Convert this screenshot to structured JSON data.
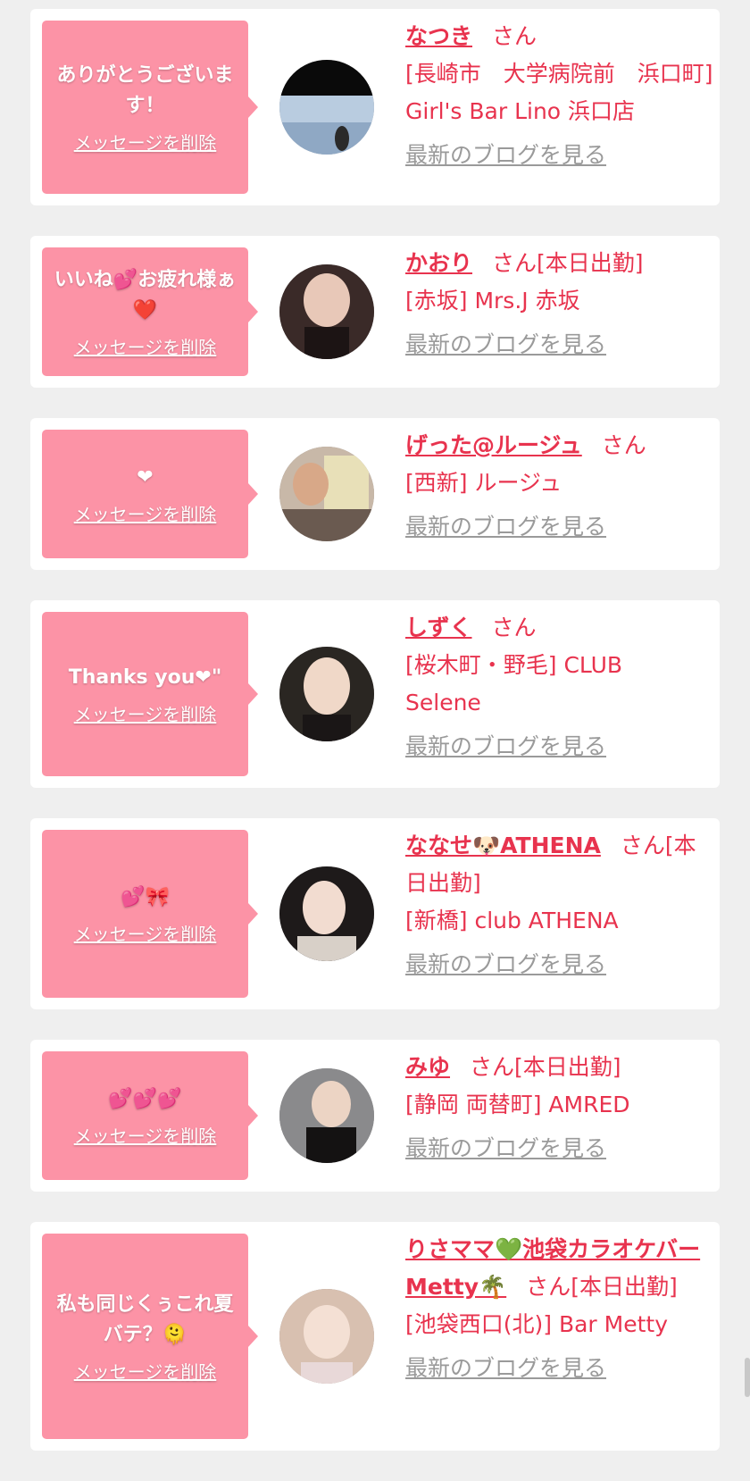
{
  "delete_label": "メッセージを削除",
  "san_label": "さん",
  "blog_label": "最新のブログを見る",
  "colors": {
    "background": "#efefef",
    "bubble": "#fc93a6",
    "accent": "#e8334e",
    "muted": "#9a9a9a"
  },
  "cards": [
    {
      "message": "ありがとうございます！",
      "name": "なつき",
      "status": "",
      "location": "[長崎市　大学病院前　浜口町] Girl's Bar Lino 浜口店"
    },
    {
      "message": "いいね💕お疲れ様ぁ❤️",
      "name": "かおり",
      "status": "[本日出勤]",
      "location": "[赤坂] Mrs.J 赤坂"
    },
    {
      "message": "❤",
      "name": "げった@ルージュ",
      "status": "",
      "location": "[西新] ルージュ"
    },
    {
      "message": "Thanks you❤\"",
      "name": "しずく",
      "status": "",
      "location": "[桜木町・野毛] CLUB Selene"
    },
    {
      "message": "💕🎀",
      "name": "ななせ🐶ATHENA",
      "status": "[本日出勤]",
      "location": "[新橋] club ATHENA"
    },
    {
      "message": "💕💕💕",
      "name": "みゆ",
      "status": "[本日出勤]",
      "location": "[静岡 両替町] AMRED"
    },
    {
      "message": "私も同じくぅこれ夏バテ？🫠",
      "name": "りさママ💚池袋カラオケバーMetty🌴",
      "status": "[本日出勤]",
      "location": "[池袋西口(北)] Bar Metty"
    }
  ]
}
